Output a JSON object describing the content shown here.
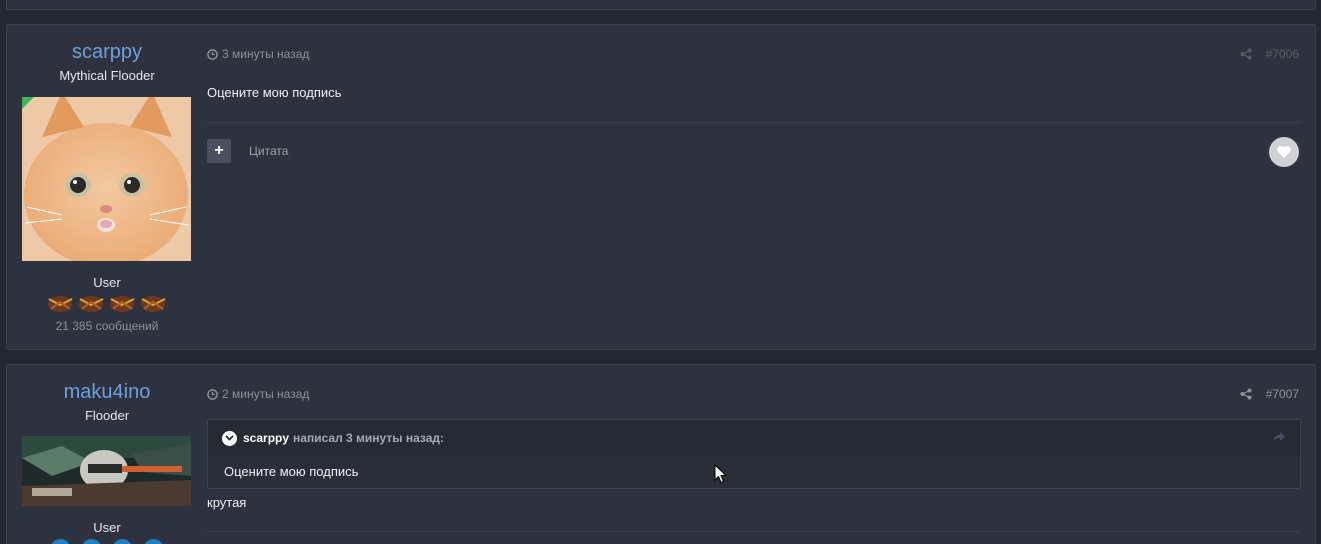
{
  "posts": [
    {
      "author": "scarppy",
      "title": "Mythical Flooder",
      "online": true,
      "group": "User",
      "post_count": "21 385 сообщений",
      "time": "3 минуты назад",
      "post_number": "#7006",
      "text": "Оцените мою подпись",
      "quote_label": "Цитата",
      "badges_icon": "hornet-badge-icon"
    },
    {
      "author": "maku4ino",
      "title": "Flooder",
      "group": "User",
      "time": "2 минуты назад",
      "post_number": "#7007",
      "quote": {
        "author": "scarppy",
        "meta": "написал 3 минуты назад:",
        "text": "Оцените мою подпись"
      },
      "text": "крутая",
      "badges_icon": "blue-orb-badge-icon"
    }
  ],
  "colors": {
    "background": "#23272f",
    "panel": "#2d323e",
    "author_link": "#6f9ee0",
    "muted": "#8b909b",
    "online": "#3cb55c"
  }
}
